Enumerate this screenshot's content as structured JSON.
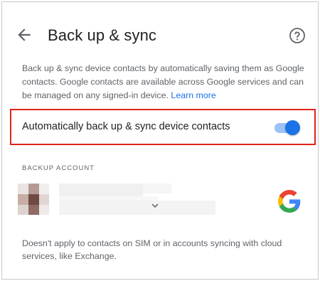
{
  "header": {
    "title": "Back up & sync",
    "back_icon": "arrow-back-icon",
    "help_icon": "help-circle-icon"
  },
  "description": {
    "text": "Back up & sync device contacts by automatically saving them as Google contacts. Google contacts are available across Google services and can be managed on any signed-in device.",
    "link_label": "Learn more"
  },
  "sync_setting": {
    "label": "Automatically back up & sync device contacts",
    "enabled": true
  },
  "backup_account": {
    "section_label": "BACKUP ACCOUNT",
    "dropdown_icon": "chevron-down-icon",
    "provider_icon": "google-logo-icon"
  },
  "footnote": {
    "text": "Doesn't apply to contacts on SIM or in accounts syncing with cloud services, like Exchange."
  },
  "colors": {
    "accent": "#1a73e8",
    "highlight_border": "#e2231a",
    "secondary_text": "#5f6368"
  }
}
